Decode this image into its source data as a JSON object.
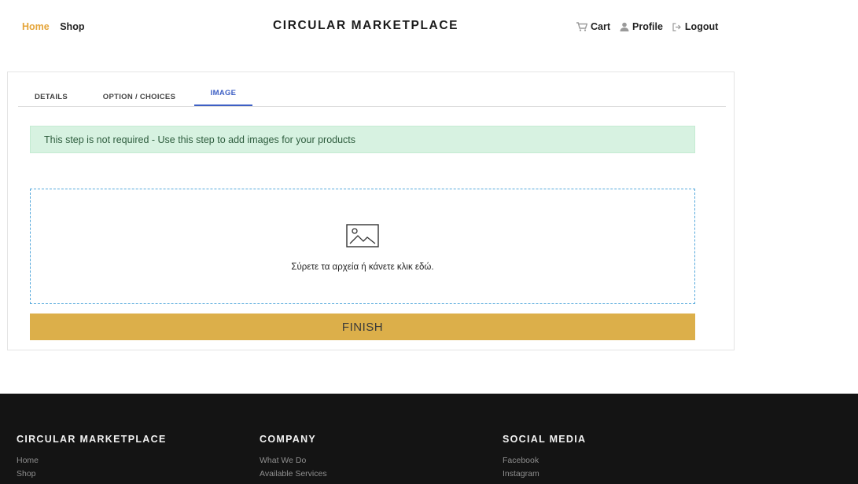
{
  "header": {
    "nav_left": [
      "Home",
      "Shop"
    ],
    "brand": "CIRCULAR MARKETPLACE",
    "nav_right": [
      {
        "label": "Cart",
        "icon": "cart-icon"
      },
      {
        "label": "Profile",
        "icon": "user-icon"
      },
      {
        "label": "Logout",
        "icon": "logout-icon"
      }
    ],
    "active_color": "#e5a53a"
  },
  "tabs": [
    "DETAILS",
    "OPTION / CHOICES",
    "IMAGE"
  ],
  "active_tab": "IMAGE",
  "alert": {
    "text": "This step is not required - Use this step to add images for your products",
    "color": "#d7f2e1"
  },
  "dropzone": {
    "icon": "image-icon",
    "text": "Σύρετε τα αρχεία ή κάνετε κλικ εδώ."
  },
  "finish_button": {
    "label": "FINISH",
    "color": "#dcaf4a"
  },
  "footer": {
    "columns": [
      {
        "title": "CIRCULAR MARKETPLACE",
        "links": [
          "Home",
          "Shop"
        ]
      },
      {
        "title": "COMPANY",
        "links": [
          "What We Do",
          "Available Services"
        ]
      },
      {
        "title": "SOCIAL MEDIA",
        "links": [
          "Facebook",
          "Instagram"
        ]
      }
    ]
  }
}
